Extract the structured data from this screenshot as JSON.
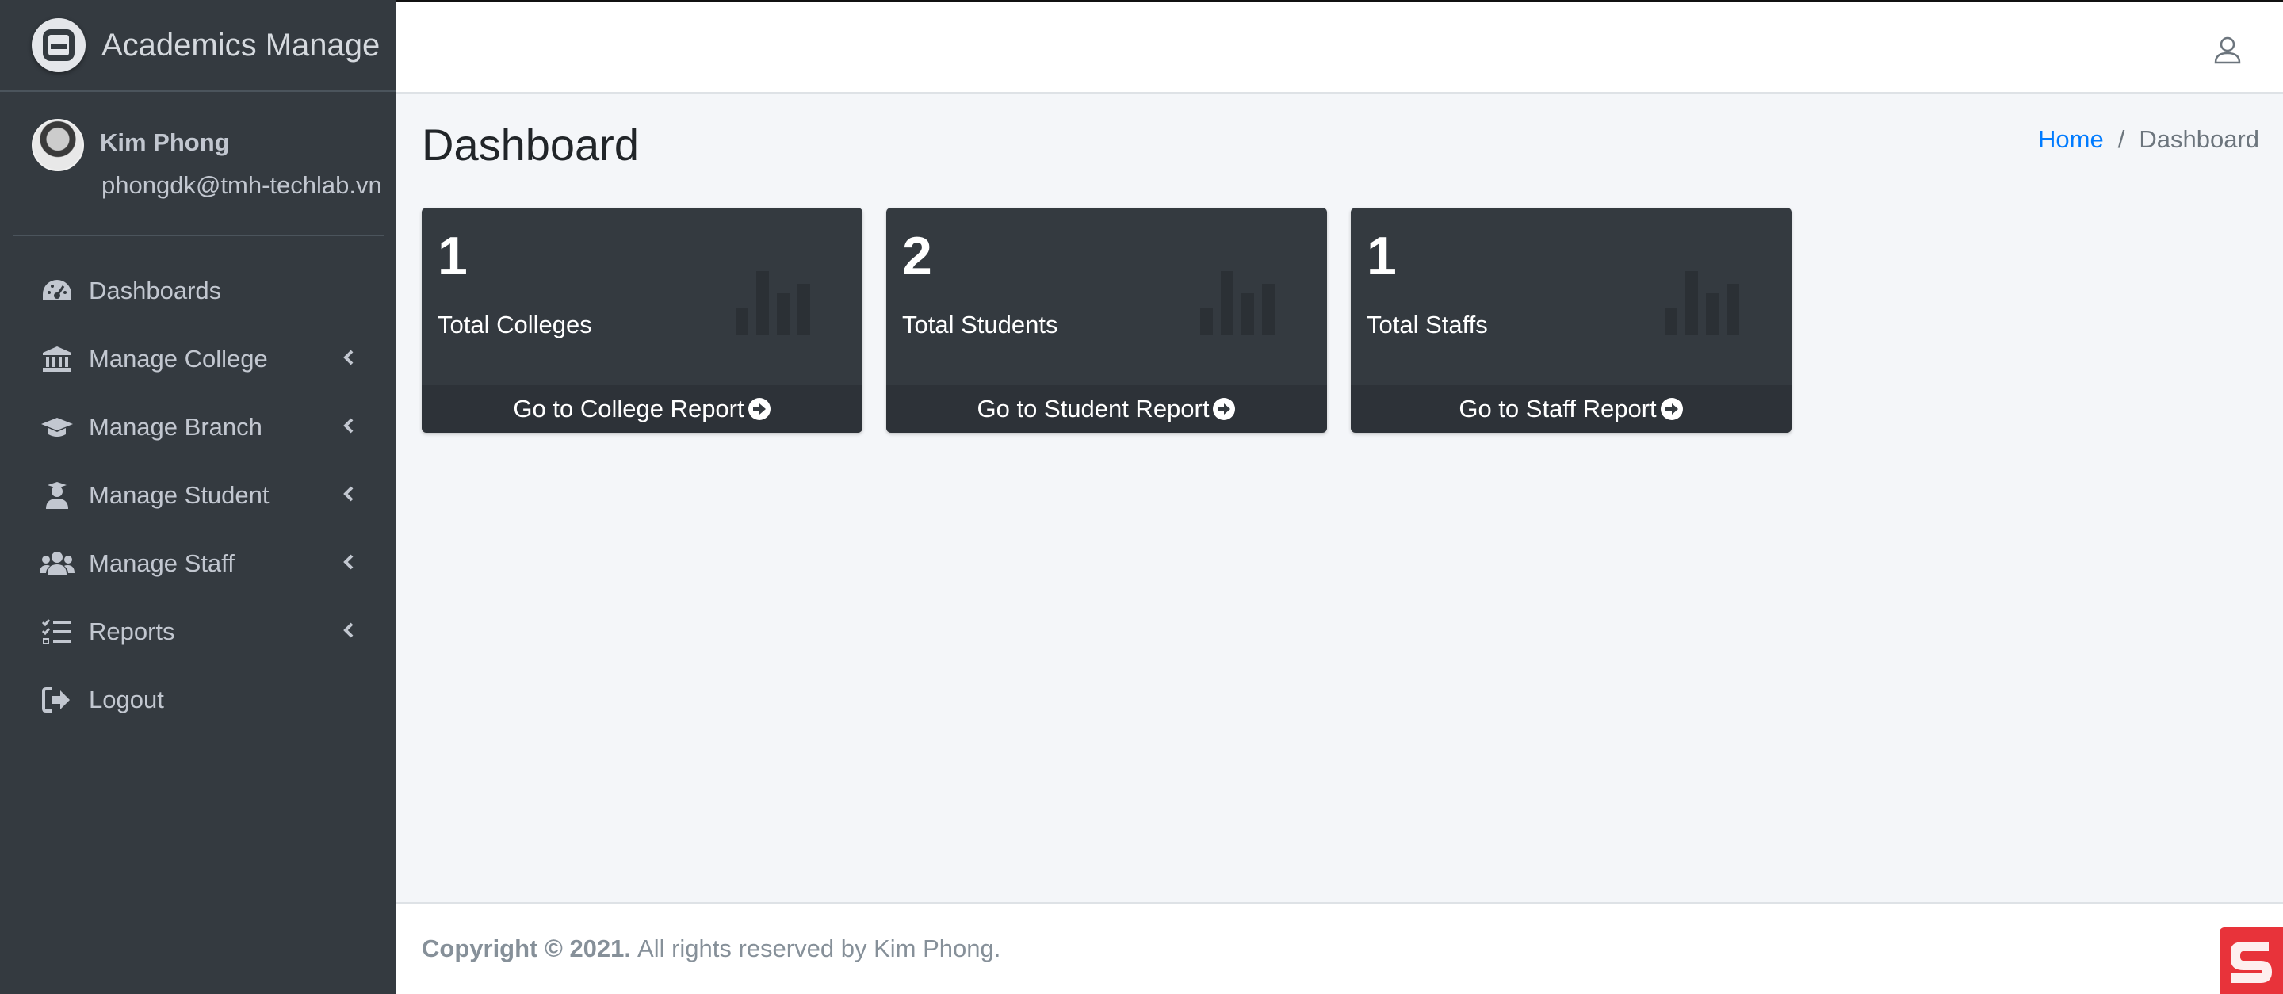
{
  "brand": {
    "name": "Academics Manage"
  },
  "user": {
    "name": "Kim Phong",
    "email": "phongdk@tmh-techlab.vn"
  },
  "nav": [
    {
      "label": "Dashboards",
      "icon": "tachometer-icon",
      "has_submenu": false
    },
    {
      "label": "Manage College",
      "icon": "university-icon",
      "has_submenu": true
    },
    {
      "label": "Manage Branch",
      "icon": "graduation-cap-icon",
      "has_submenu": true
    },
    {
      "label": "Manage Student",
      "icon": "user-graduate-icon",
      "has_submenu": true
    },
    {
      "label": "Manage Staff",
      "icon": "users-icon",
      "has_submenu": true
    },
    {
      "label": "Reports",
      "icon": "tasks-icon",
      "has_submenu": true
    },
    {
      "label": "Logout",
      "icon": "sign-out-icon",
      "has_submenu": false
    }
  ],
  "header": {
    "title": "Dashboard"
  },
  "breadcrumb": {
    "home": "Home",
    "separator": "/",
    "current": "Dashboard"
  },
  "cards": [
    {
      "value": "1",
      "label": "Total Colleges",
      "link": "Go to College Report"
    },
    {
      "value": "2",
      "label": "Total Students",
      "link": "Go to Student Report"
    },
    {
      "value": "1",
      "label": "Total Staffs",
      "link": "Go to Staff Report"
    }
  ],
  "footer": {
    "copyright": "Copyright © 2021.",
    "text": "All rights reserved by Kim Phong."
  },
  "colors": {
    "sidebar": "#343a40",
    "link": "#007bff",
    "background": "#f4f6f9",
    "badge": "#e8333a"
  }
}
